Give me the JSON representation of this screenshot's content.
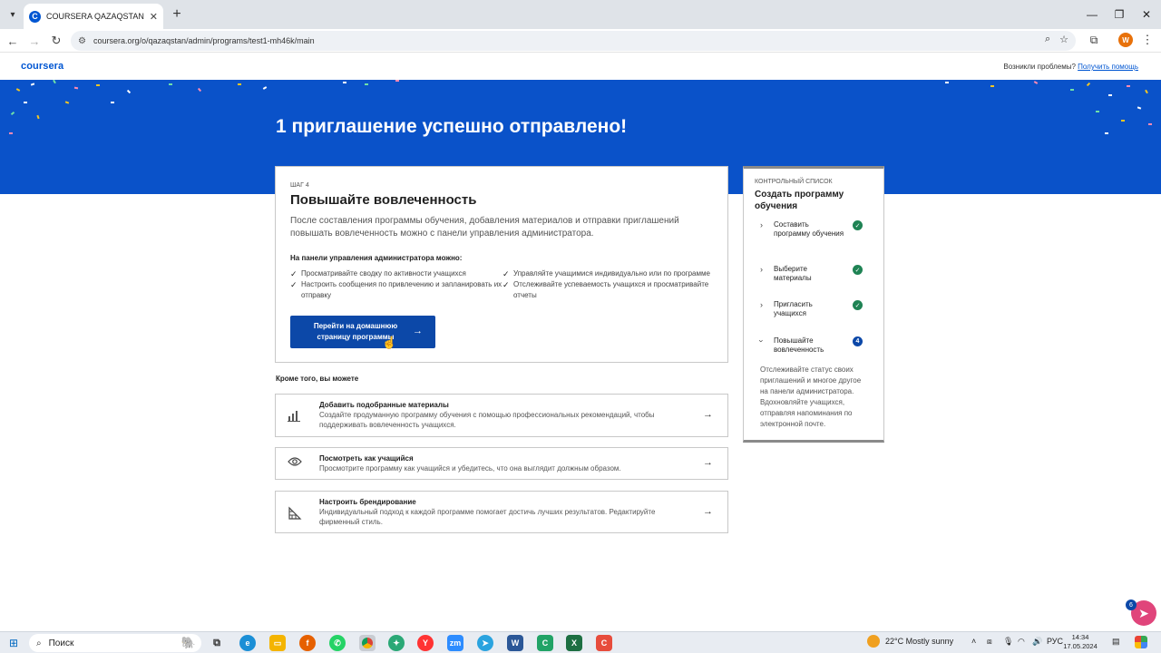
{
  "browser": {
    "tab_title": "COURSERA QAZAQSTAN Адми",
    "tab_favicon_letter": "C",
    "url": "coursera.org/o/qazaqstan/admin/programs/test1-mh46k/main",
    "profile_initial": "W"
  },
  "header": {
    "logo": "coursera",
    "help_question": "Возникли проблемы?",
    "help_link": "Получить помощь"
  },
  "banner": {
    "title": "1 приглашение успешно отправлено!",
    "bg_color": "#0a52c9"
  },
  "step_card": {
    "step_label": "ШАГ 4",
    "heading": "Повышайте вовлеченность",
    "description": "После составления программы обучения, добавления материалов и отправки приглашений повышать вовлеченность можно с панели управления администратора.",
    "admin_can_label": "На панели управления администратора можно:",
    "features": [
      "Просматривайте сводку по активности учащихся",
      "Настроить сообщения по привлечению и запланировать их отправку",
      "Управляйте учащимися индивидуально или по программе",
      "Отслеживайте успеваемость учащихся и просматривайте отчеты"
    ],
    "primary_button": "Перейти на домашнюю страницу программы"
  },
  "also": {
    "label": "Кроме того, вы можете",
    "actions": [
      {
        "icon": "chart-icon",
        "title": "Добавить подобранные материалы",
        "description": "Создайте продуманную программу обучения с помощью профессиональных рекомендаций, чтобы поддерживать вовлеченность учащихся."
      },
      {
        "icon": "eye-icon",
        "title": "Посмотреть как учащийся",
        "description": "Просмотрите программу как учащийся и убедитесь, что она выглядит должным образом."
      },
      {
        "icon": "branding-icon",
        "title": "Настроить брендирование",
        "description": "Индивидуальный подход к каждой программе помогает достичь лучших результатов. Редактируйте фирменный стиль."
      }
    ]
  },
  "checklist": {
    "small_label": "КОНТРОЛЬНЫЙ СПИСОК",
    "title": "Создать программу обучения",
    "items": [
      {
        "label": "Составить программу обучения",
        "status": "done"
      },
      {
        "label": "Выберите материалы",
        "status": "done"
      },
      {
        "label": "Пригласить учащихся",
        "status": "done"
      },
      {
        "label": "Повышайте вовлеченность",
        "status": "current",
        "step": "4"
      }
    ],
    "description": "Отслеживайте статус своих приглашений и многое другое на панели администратора. Вдохновляйте учащихся, отправляя напоминания по электронной почте."
  },
  "help_bubble_badge": "6",
  "taskbar": {
    "search_label": "Поиск",
    "weather": "22°C  Mostly sunny",
    "language": "РУС",
    "time": "14:34",
    "date": "17.05.2024"
  }
}
